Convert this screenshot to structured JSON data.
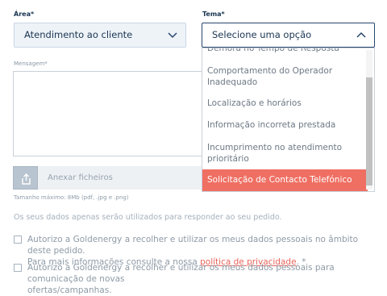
{
  "form": {
    "area": {
      "label": "Área*",
      "value": "Atendimento ao cliente"
    },
    "tema": {
      "label": "Tema*",
      "placeholder": "Selecione uma opção",
      "options": [
        "Demora no Tempo de Resposta",
        "Comportamento do Operador Inadequado",
        "Localização e horários",
        "Informação incorreta prestada",
        "Incumprimento no atendimento prioritário",
        "Solicitação de Contacto Telefónico"
      ],
      "highlighted_option": "Solicitação de Contacto Telefónico"
    },
    "mensagem": {
      "label": "Mensagem*"
    },
    "attachments": {
      "label": "Anexar ficheiros",
      "hint": "Tamanho máximo: 8Mb (pdf, .jpg e .png)"
    },
    "privacy_notice": "Os seus dados apenas serão utilizados para responder ao seu pedido.",
    "consent1": {
      "text_line1": "Autorizo a Goldenergy a recolher e utilizar os meus dados pessoais no âmbito deste pedido.",
      "text_line2_before": "Para mais informações consulte a nossa ",
      "link": "política de privacidade",
      "text_line2_after": ". *"
    },
    "consent2": {
      "text_line1": "Autorizo a Goldenergy a recolher e utilizar os meus dados pessoais para comunicação de novas",
      "text_line2": "ofertas/campanhas."
    }
  },
  "colors": {
    "primary": "#1a3552",
    "accent": "#ef6f63",
    "muted": "#8e9aa6"
  },
  "icons": {
    "dropdown": "chevron-down-icon",
    "dropdown_open": "chevron-up-icon",
    "upload": "upload-icon"
  }
}
